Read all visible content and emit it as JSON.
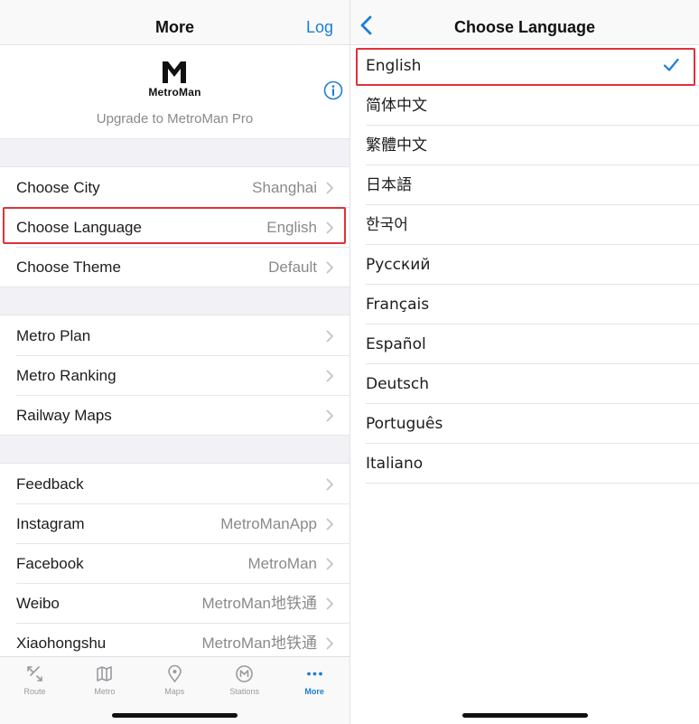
{
  "left": {
    "title": "More",
    "nav_right": "Log",
    "brand": {
      "logo_text": "MetroMan",
      "upgrade": "Upgrade to MetroMan Pro"
    },
    "group1": [
      {
        "label": "Choose City",
        "value": "Shanghai"
      },
      {
        "label": "Choose Language",
        "value": "English"
      },
      {
        "label": "Choose Theme",
        "value": "Default"
      }
    ],
    "group2": [
      {
        "label": "Metro Plan",
        "value": ""
      },
      {
        "label": "Metro Ranking",
        "value": ""
      },
      {
        "label": "Railway Maps",
        "value": ""
      }
    ],
    "group3": [
      {
        "label": "Feedback",
        "value": ""
      },
      {
        "label": "Instagram",
        "value": "MetroManApp"
      },
      {
        "label": "Facebook",
        "value": "MetroMan"
      },
      {
        "label": "Weibo",
        "value": "MetroMan地铁通"
      },
      {
        "label": "Xiaohongshu",
        "value": "MetroMan地铁通"
      }
    ],
    "tabs": [
      {
        "label": "Route",
        "icon": "route-icon"
      },
      {
        "label": "Metro",
        "icon": "map-book-icon"
      },
      {
        "label": "Maps",
        "icon": "location-pin-icon"
      },
      {
        "label": "Stations",
        "icon": "metro-logo-icon"
      },
      {
        "label": "More",
        "icon": "more-dots-icon",
        "active": true
      }
    ]
  },
  "right": {
    "title": "Choose Language",
    "languages": [
      {
        "label": "English",
        "selected": true
      },
      {
        "label": "简体中文"
      },
      {
        "label": "繁體中文"
      },
      {
        "label": "日本語"
      },
      {
        "label": "한국어"
      },
      {
        "label": "Русский"
      },
      {
        "label": "Français"
      },
      {
        "label": "Español"
      },
      {
        "label": "Deutsch"
      },
      {
        "label": "Português"
      },
      {
        "label": "Italiano"
      }
    ]
  },
  "colors": {
    "accent": "#1a7fd6",
    "highlight": "#e0313a",
    "secondary_text": "#8a8a8e",
    "group_background": "#f2f2f6"
  }
}
